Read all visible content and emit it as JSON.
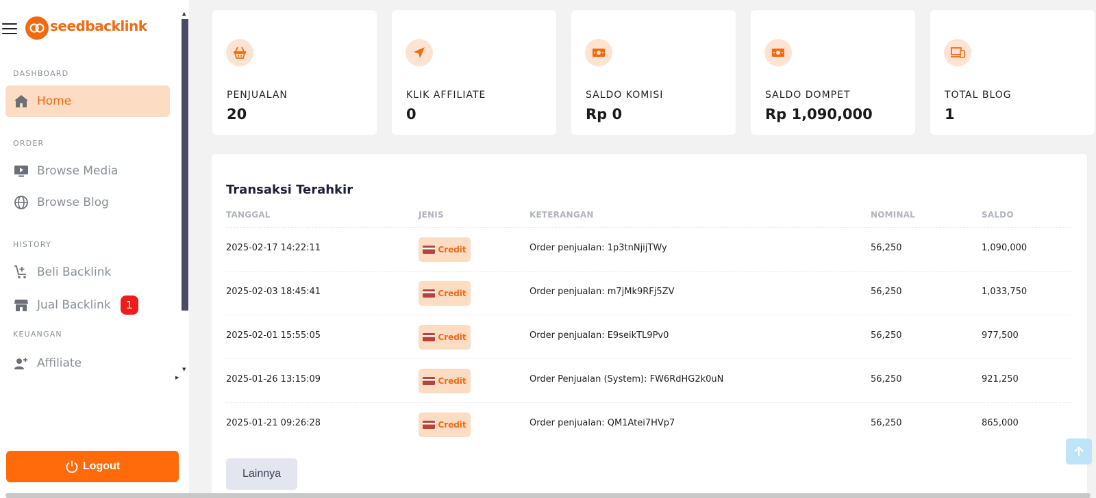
{
  "brand": {
    "name": "seedbacklink",
    "color": "#f26a10"
  },
  "sidebar": {
    "sections": {
      "dashboard": "DASHBOARD",
      "order": "ORDER",
      "history": "HISTORY",
      "keuangan": "KEUANGAN"
    },
    "items": {
      "home": {
        "label": "Home",
        "icon": "home-icon",
        "active": true
      },
      "browse_media": {
        "label": "Browse Media",
        "icon": "monitor-play-icon"
      },
      "browse_blog": {
        "label": "Browse Blog",
        "icon": "globe-icon"
      },
      "beli_backlink": {
        "label": "Beli Backlink",
        "icon": "cart-plus-icon"
      },
      "jual_backlink": {
        "label": "Jual Backlink",
        "icon": "store-icon",
        "badge": "1"
      },
      "affiliate": {
        "label": "Affiliate",
        "icon": "user-plus-icon"
      }
    },
    "logout": {
      "label": "Logout",
      "icon": "power-icon"
    }
  },
  "stats": [
    {
      "label": "PENJUALAN",
      "value": "20",
      "icon": "basket-icon"
    },
    {
      "label": "KLIK AFFILIATE",
      "value": "0",
      "icon": "navigation-arrow-icon"
    },
    {
      "label": "SALDO KOMISI",
      "value": "Rp 0",
      "icon": "cash-icon"
    },
    {
      "label": "SALDO DOMPET",
      "value": "Rp 1,090,000",
      "icon": "cash-icon"
    },
    {
      "label": "TOTAL BLOG",
      "value": "1",
      "icon": "devices-icon"
    }
  ],
  "transactions": {
    "title": "Transaksi Terahkir",
    "headers": {
      "tanggal": "TANGGAL",
      "jenis": "JENIS",
      "keterangan": "KETERANGAN",
      "nominal": "NOMINAL",
      "saldo": "SALDO"
    },
    "rows": [
      {
        "tanggal": "2025-02-17 14:22:11",
        "jenis": "Credit",
        "keterangan": "Order penjualan: 1p3tnNjijTWy",
        "nominal": "56,250",
        "saldo": "1,090,000"
      },
      {
        "tanggal": "2025-02-03 18:45:41",
        "jenis": "Credit",
        "keterangan": "Order penjualan: m7jMk9RFj5ZV",
        "nominal": "56,250",
        "saldo": "1,033,750"
      },
      {
        "tanggal": "2025-02-01 15:55:05",
        "jenis": "Credit",
        "keterangan": "Order penjualan: E9seikTL9Pv0",
        "nominal": "56,250",
        "saldo": "977,500"
      },
      {
        "tanggal": "2025-01-26 13:15:09",
        "jenis": "Credit",
        "keterangan": "Order Penjualan (System): FW6RdHG2k0uN",
        "nominal": "56,250",
        "saldo": "921,250"
      },
      {
        "tanggal": "2025-01-21 09:26:28",
        "jenis": "Credit",
        "keterangan": "Order penjualan: QM1Atei7HVp7",
        "nominal": "56,250",
        "saldo": "865,000"
      }
    ],
    "more_label": "Lainnya"
  },
  "colors": {
    "accent": "#ff6a0a",
    "accent_soft": "#fddcc4",
    "badge": "#ee1c1c"
  }
}
